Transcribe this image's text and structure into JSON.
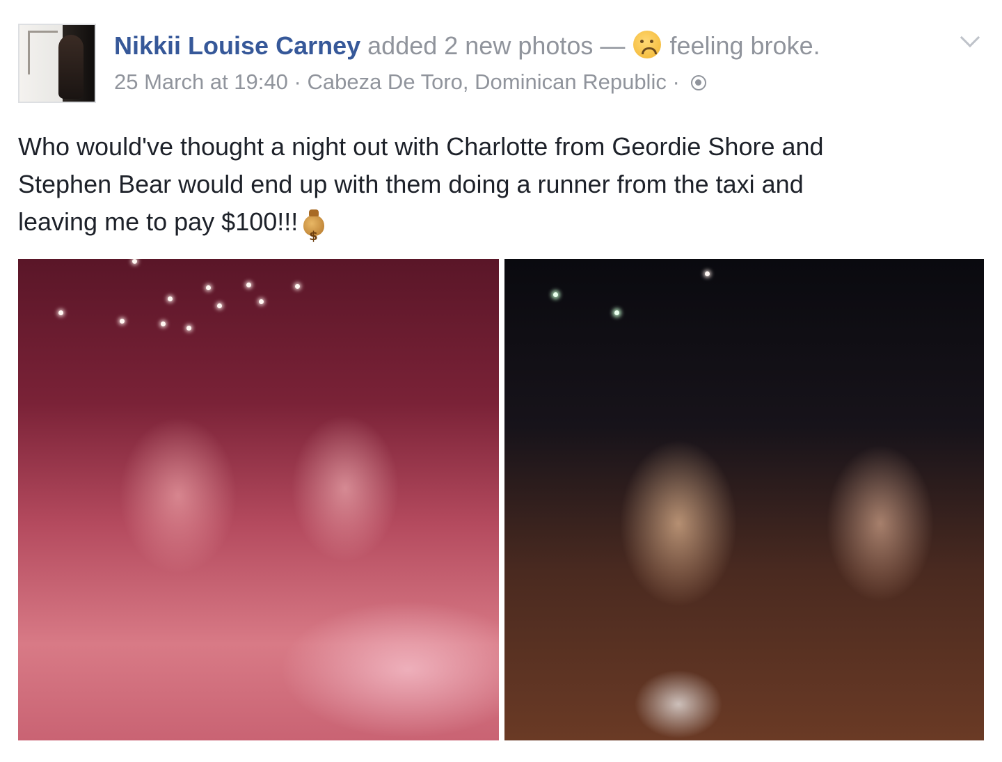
{
  "post": {
    "author": "Nikkii Louise Carney",
    "action": "added 2 new photos —",
    "feeling": "feeling broke.",
    "date": "25 March at 19:40",
    "separator": "·",
    "location": "Cabeza De Toro, Dominican Republic",
    "separator2": "·",
    "text_lines": [
      "Who would've thought a night out with Charlotte from Geordie Shore and",
      "Stephen Bear would end up with them doing a runner from the taxi and",
      "leaving me to pay $100!!!"
    ]
  },
  "icons": {
    "feeling": "disappointed-face-icon",
    "privacy": "globe-icon",
    "menu": "chevron-down-icon",
    "emoji": "money-bag-icon"
  },
  "colors": {
    "author_link": "#365899",
    "meta_text": "#90949c",
    "body_text": "#1d2129"
  }
}
